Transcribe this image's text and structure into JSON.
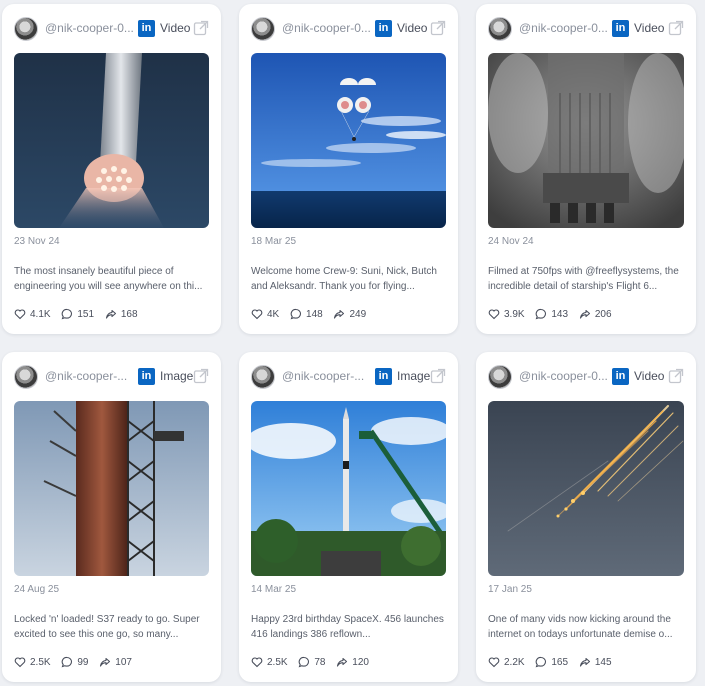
{
  "posts": [
    {
      "handle": "@nik-cooper-0...",
      "platform_icon": "linkedin-icon",
      "type": "Video",
      "image": "starship-booster-engines",
      "date": "23 Nov 24",
      "text": "The most insanely beautiful piece of engineering you will see anywhere on thi...",
      "likes": "4.1K",
      "comments": "151",
      "shares": "168"
    },
    {
      "handle": "@nik-cooper-0...",
      "platform_icon": "linkedin-icon",
      "type": "Video",
      "image": "capsule-parachutes-ocean",
      "date": "18 Mar 25",
      "text": "Welcome home Crew-9: Suni, Nick, Butch and Aleksandr. Thank you for flying...",
      "likes": "4K",
      "comments": "148",
      "shares": "249"
    },
    {
      "handle": "@nik-cooper-0...",
      "platform_icon": "linkedin-icon",
      "type": "Video",
      "image": "starship-hot-staging",
      "date": "24 Nov 24",
      "text": "Filmed at 750fps with @freeflysystems, the incredible detail of starship's Flight 6...",
      "likes": "3.9K",
      "comments": "143",
      "shares": "206"
    },
    {
      "handle": "@nik-cooper-...",
      "platform_icon": "linkedin-icon",
      "type": "Image",
      "image": "starship-on-tower",
      "date": "24 Aug 25",
      "text": "Locked 'n' loaded! S37 ready to go. Super excited to see this one go, so many...",
      "likes": "2.5K",
      "comments": "99",
      "shares": "107"
    },
    {
      "handle": "@nik-cooper-...",
      "platform_icon": "linkedin-icon",
      "type": "Image",
      "image": "falcon-1-launch-pad",
      "date": "14 Mar 25",
      "text": "Happy 23rd birthday SpaceX. 456 launches 416 landings 386 reflown...",
      "likes": "2.5K",
      "comments": "78",
      "shares": "120"
    },
    {
      "handle": "@nik-cooper-0...",
      "platform_icon": "linkedin-icon",
      "type": "Video",
      "image": "debris-streaks-sky",
      "date": "17 Jan 25",
      "text": "One of many vids now kicking around the internet on todays unfortunate demise o...",
      "likes": "2.2K",
      "comments": "165",
      "shares": "145"
    }
  ],
  "icons": {
    "platform": "in",
    "like": "heart-icon",
    "comment": "comment-icon",
    "share": "share-icon",
    "external": "external-link-icon"
  },
  "colors": {
    "linkedin": "#0a66c2",
    "background": "#eef0f4",
    "card": "#ffffff"
  }
}
